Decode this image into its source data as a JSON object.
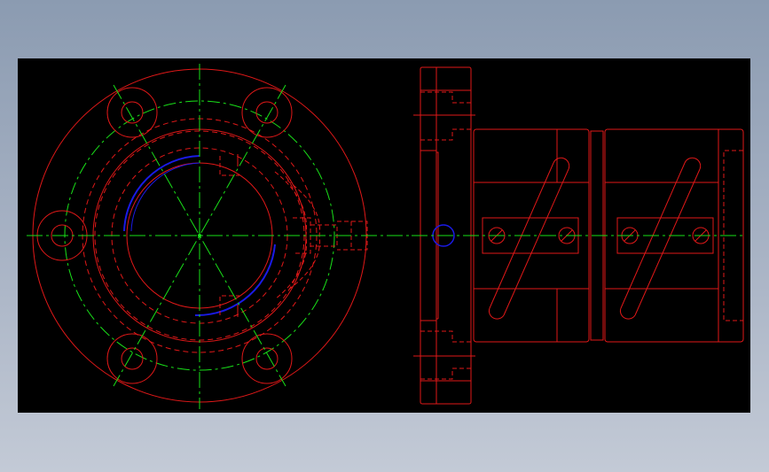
{
  "drawing": {
    "colors": {
      "page_background_top": "#8b9bb1",
      "page_background_bottom": "#c3cad6",
      "viewport_background": "#000000",
      "outline": "#e01818",
      "hidden_line": "#e01818",
      "centerline": "#19e019",
      "highlight_arc": "#1a1ae6"
    },
    "views": [
      {
        "name": "front-view",
        "type": "flange face with 6 bolt holes"
      },
      {
        "name": "side-view",
        "type": "coupling side elevation"
      }
    ],
    "front_view": {
      "bolt_hole_count": 6
    },
    "side_view": {
      "cross_pin_count": 4,
      "slot_count": 2
    }
  }
}
